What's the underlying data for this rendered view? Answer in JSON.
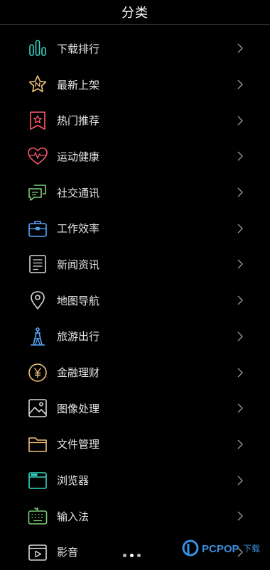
{
  "header": {
    "title": "分类"
  },
  "categories": [
    {
      "label": "下载排行",
      "icon": "download-rank-icon",
      "color": "#36d6c4"
    },
    {
      "label": "最新上架",
      "icon": "new-star-icon",
      "color": "#f0c27a"
    },
    {
      "label": "热门推荐",
      "icon": "hot-badge-icon",
      "color": "#ff5a6e"
    },
    {
      "label": "运动健康",
      "icon": "heartbeat-icon",
      "color": "#ff5a6e"
    },
    {
      "label": "社交通讯",
      "icon": "chat-icon",
      "color": "#7ed07a"
    },
    {
      "label": "工作效率",
      "icon": "briefcase-icon",
      "color": "#5aa8ff"
    },
    {
      "label": "新闻资讯",
      "icon": "news-icon",
      "color": "#d8d8d8"
    },
    {
      "label": "地图导航",
      "icon": "map-pin-icon",
      "color": "#d8d8d8"
    },
    {
      "label": "旅游出行",
      "icon": "tower-icon",
      "color": "#5aa8ff"
    },
    {
      "label": "金融理财",
      "icon": "yuan-icon",
      "color": "#f0c27a"
    },
    {
      "label": "图像处理",
      "icon": "image-icon",
      "color": "#d8d8d8"
    },
    {
      "label": "文件管理",
      "icon": "folder-icon",
      "color": "#f0c27a"
    },
    {
      "label": "浏览器",
      "icon": "browser-icon",
      "color": "#36d6c4"
    },
    {
      "label": "输入法",
      "icon": "keyboard-icon",
      "color": "#7ed07a"
    },
    {
      "label": "影音",
      "icon": "video-icon",
      "color": "#d8d8d8"
    }
  ],
  "chevron": "chevron-right-icon",
  "watermark": {
    "brand": "PCPOP",
    "suffix": "下载"
  }
}
